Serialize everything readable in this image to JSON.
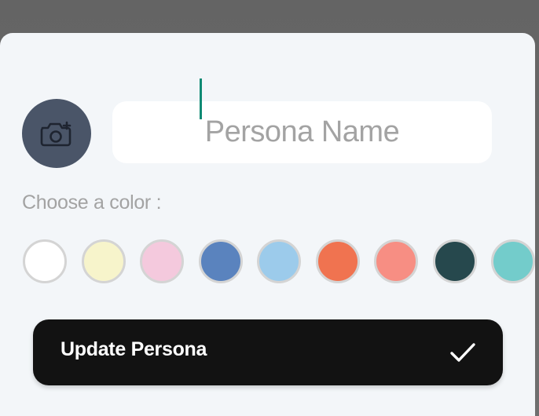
{
  "persona": {
    "name_placeholder": "Persona Name",
    "name_value": "",
    "avatar_icon": "camera-add-icon",
    "avatar_color": "#4a5568"
  },
  "color_picker": {
    "label": "Choose a color :",
    "options": [
      {
        "color": "#ffffff"
      },
      {
        "color": "#f7f4cb"
      },
      {
        "color": "#f4c9dd"
      },
      {
        "color": "#5a83be"
      },
      {
        "color": "#9ccbeb"
      },
      {
        "color": "#f07350"
      },
      {
        "color": "#f78e83"
      },
      {
        "color": "#26484d"
      },
      {
        "color": "#73cccb"
      }
    ]
  },
  "actions": {
    "update_label": "Update Persona",
    "update_icon": "checkmark-icon"
  },
  "theme": {
    "sheet_bg": "#f3f6f9",
    "caret_color": "#0f8a74",
    "button_bg": "#121212"
  }
}
